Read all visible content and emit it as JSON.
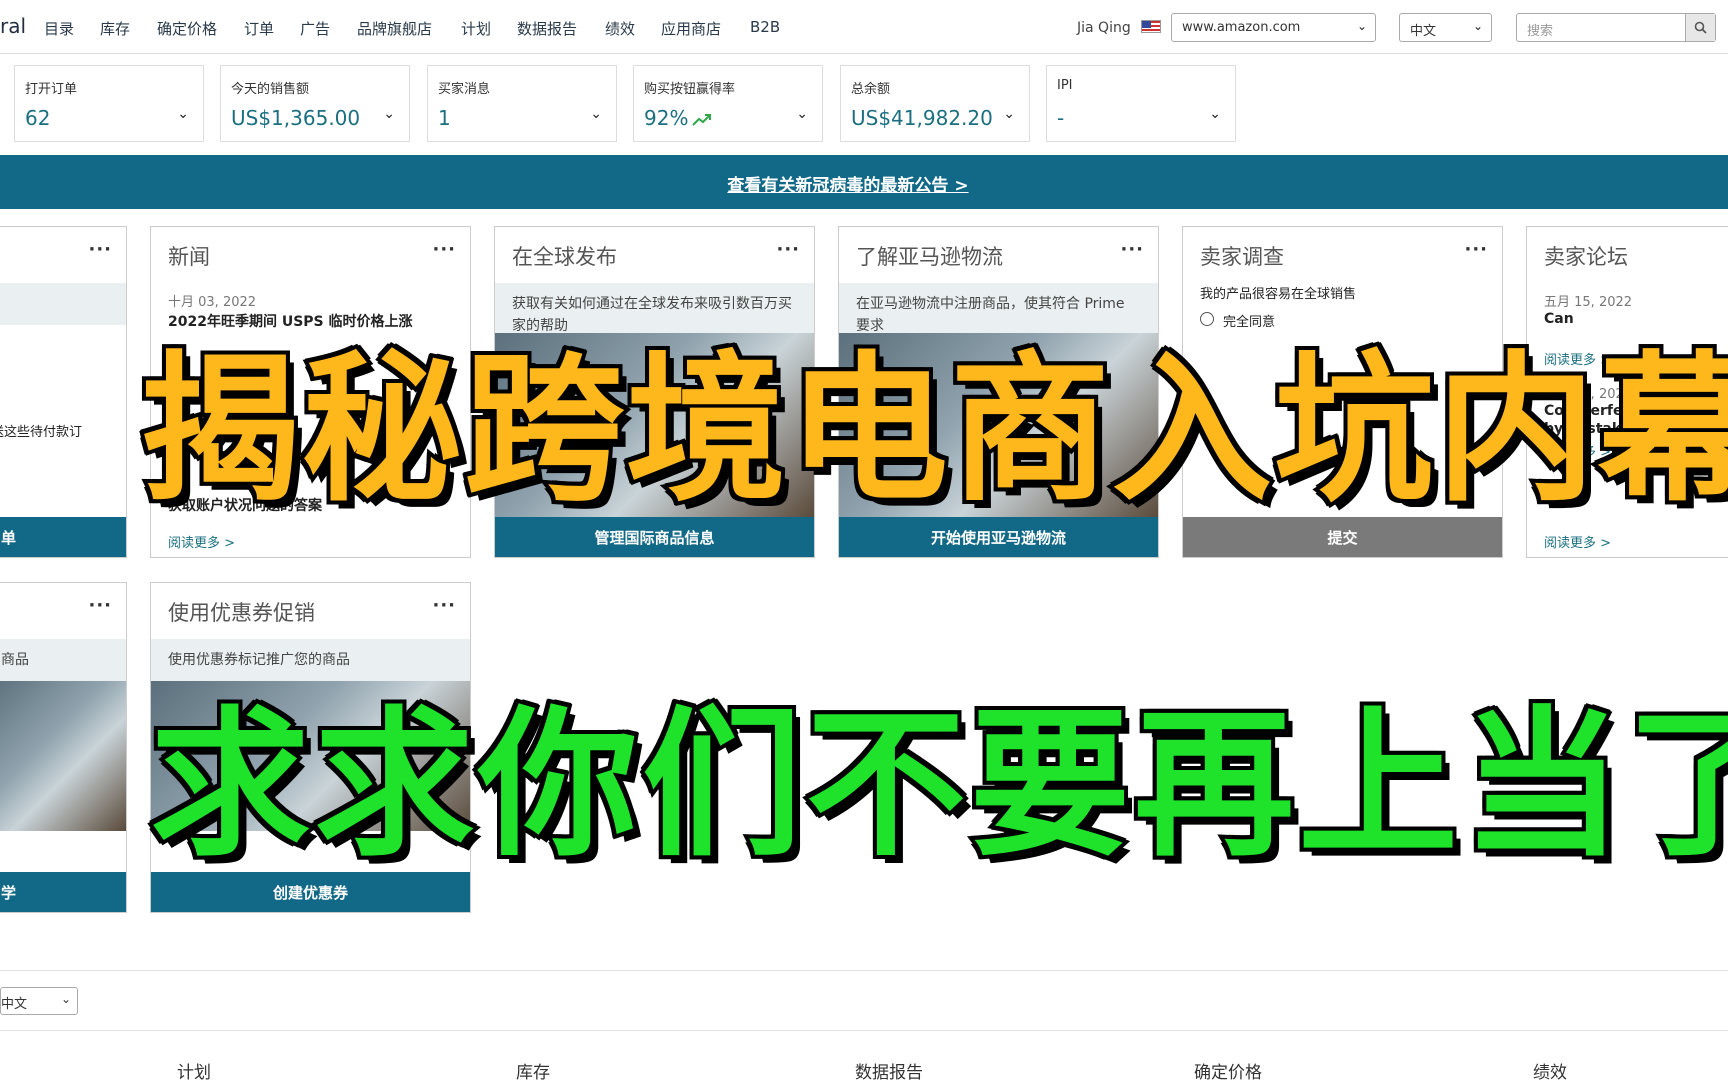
{
  "nav": {
    "brand": "ral",
    "items": [
      "目录",
      "库存",
      "确定价格",
      "订单",
      "广告",
      "品牌旗舰店",
      "计划",
      "数据报告",
      "绩效",
      "应用商店",
      "B2B"
    ],
    "user_name": "Jia Qing",
    "marketplace": "www.amazon.com",
    "language": "中文",
    "search_placeholder": "搜索"
  },
  "metrics": [
    {
      "label": "打开订单",
      "value": "62"
    },
    {
      "label": "今天的销售额",
      "value": "US$1,365.00"
    },
    {
      "label": "买家消息",
      "value": "1"
    },
    {
      "label": "购买按钮赢得率",
      "value": "92%"
    },
    {
      "label": "总余额",
      "value": "US$41,982.20"
    },
    {
      "label": "IPI",
      "value": "-"
    }
  ],
  "banner": {
    "text": "查看有关新冠病毒的最新公告 >"
  },
  "cards_row1": [
    {
      "title": "",
      "desc": "",
      "text": "送这些待付款订",
      "button": "单"
    },
    {
      "title": "新闻",
      "date": "十月 03, 2022",
      "headline": "2022年旺季期间 USPS 临时价格上涨",
      "text": "获取账户状况问题的答案",
      "link": "阅读更多 >"
    },
    {
      "title": "在全球发布",
      "desc": "获取有关如何通过在全球发布来吸引数百万买家的帮助",
      "button": "管理国际商品信息"
    },
    {
      "title": "了解亚马逊物流",
      "desc": "在亚马逊物流中注册商品，使其符合 Prime 要求",
      "button": "开始使用亚马逊物流"
    },
    {
      "title": "卖家调查",
      "question": "我的产品很容易在全球销售",
      "option": "完全同意",
      "button": "提交"
    },
    {
      "title": "卖家论坛",
      "date1": "五月 15, 2022",
      "line1": "Can",
      "link1": "阅读更多 >",
      "date2": "五月 15, 2022",
      "line2": "Counterfeit performance n",
      "line3": "by mistake? If you do",
      "link2": "阅读更多 >",
      "link3": "阅读更多 >"
    }
  ],
  "cards_row2": [
    {
      "title": "",
      "desc": "商品",
      "button": "学"
    },
    {
      "title": "使用优惠券促销",
      "desc": "使用优惠券标记推广您的商品",
      "button": "创建优惠券"
    }
  ],
  "overlay": {
    "line1": "揭秘跨境电商入坑内幕",
    "line2": "求求你们不要再上当了"
  },
  "footer": {
    "language": "中文",
    "links": [
      "计划",
      "库存",
      "数据报告",
      "确定价格",
      "绩效"
    ]
  },
  "colors": {
    "accent": "#126887",
    "value_text": "#1b6f80",
    "overlay1": "#ffb81c",
    "overlay2": "#1fe22b"
  }
}
